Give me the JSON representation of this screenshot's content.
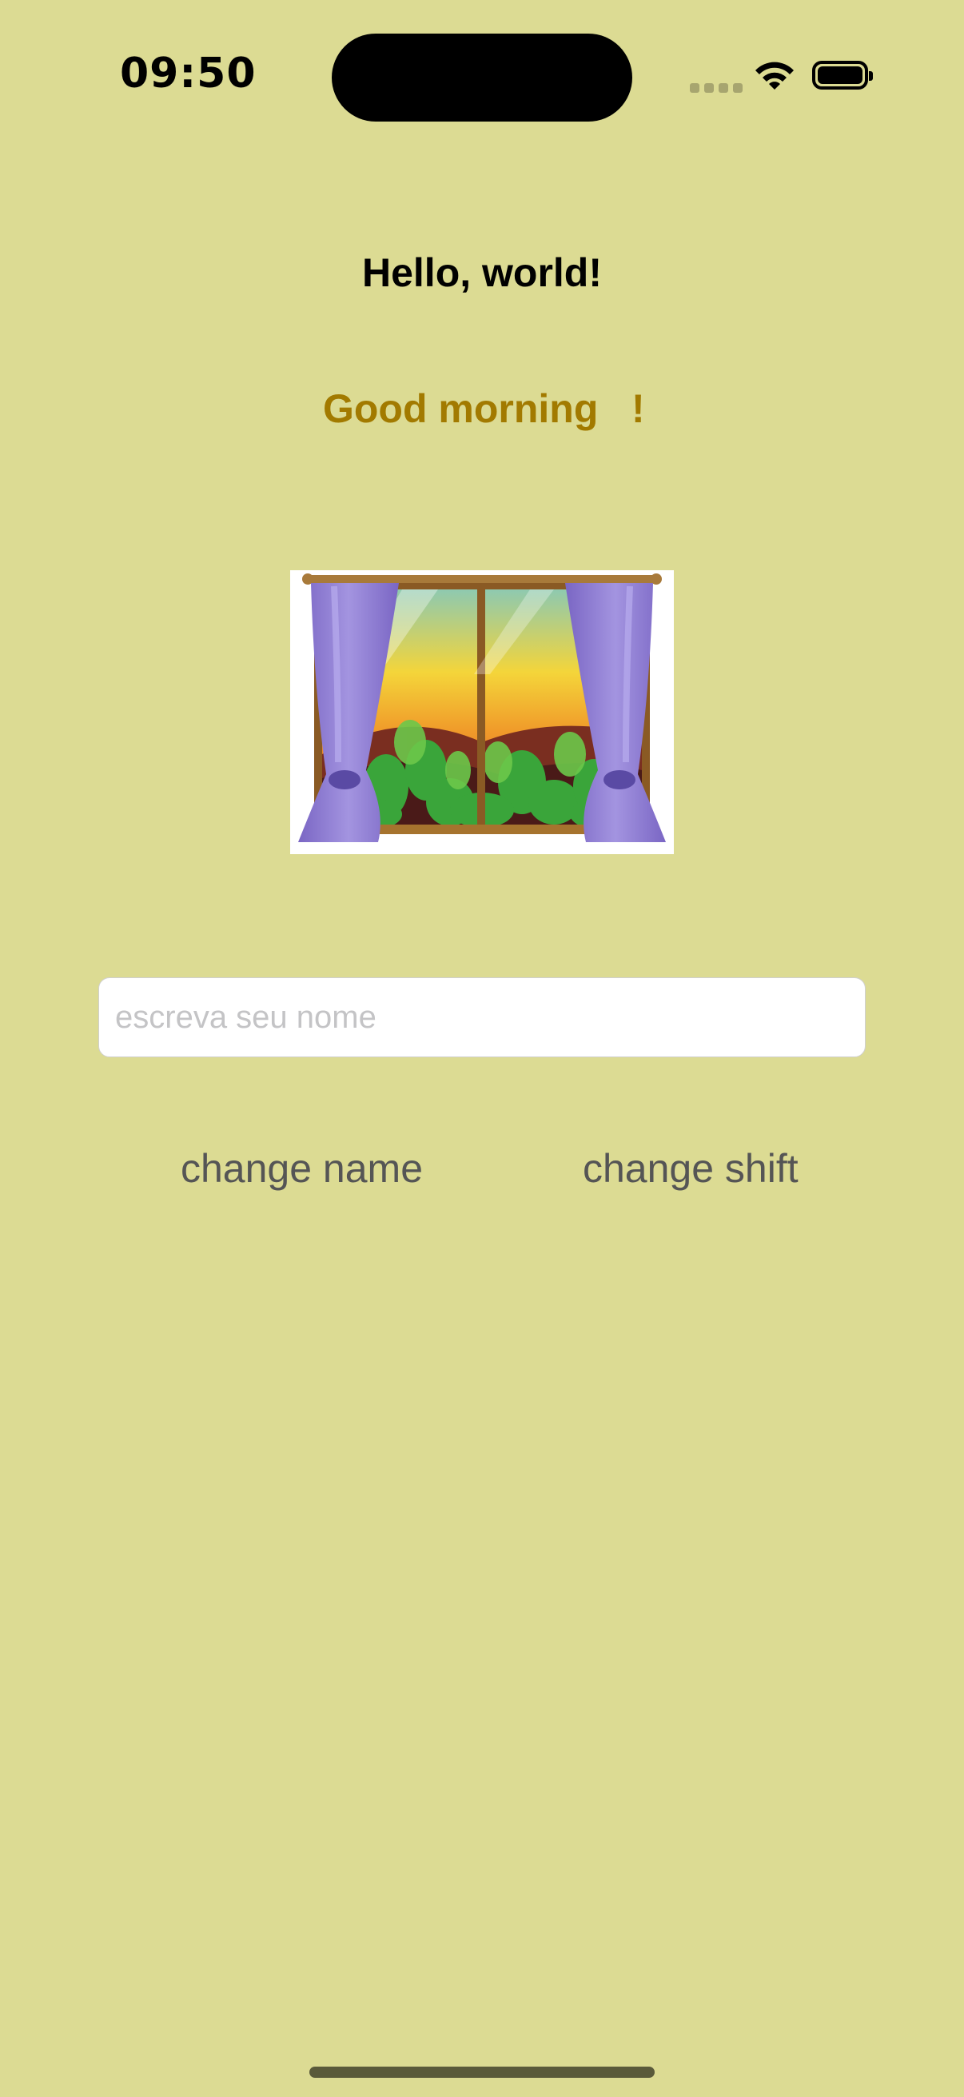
{
  "status_bar": {
    "time": "09:50",
    "icons": [
      "cellular-signal-icon",
      "wifi-icon",
      "battery-icon"
    ]
  },
  "main": {
    "title": "Hello, world!",
    "greeting": "Good morning   !",
    "image": {
      "description_icon": "window-with-curtains-illustration"
    },
    "name_input": {
      "value": "",
      "placeholder": "escreva seu nome"
    },
    "buttons": {
      "change_name": "change name",
      "change_shift": "change shift"
    }
  },
  "colors": {
    "background": "#dcdb93",
    "greeting": "#a27a00",
    "button_text": "#555555",
    "curtain": "#8f7fd0"
  }
}
